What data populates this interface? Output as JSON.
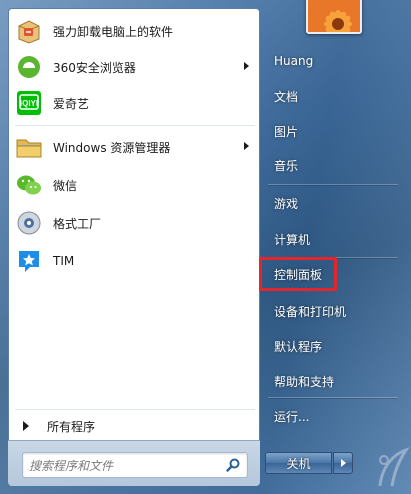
{
  "left_programs": [
    {
      "label": "强力卸载电脑上的软件",
      "icon": "uninstaller-box-icon",
      "has_submenu": false
    },
    {
      "label": "360安全浏览器",
      "icon": "360-browser-icon",
      "has_submenu": true
    },
    {
      "label": "爱奇艺",
      "icon": "iqiyi-icon",
      "has_submenu": false
    },
    {
      "label": "Windows 资源管理器",
      "icon": "explorer-folder-icon",
      "has_submenu": true
    },
    {
      "label": "微信",
      "icon": "wechat-icon",
      "has_submenu": false
    },
    {
      "label": "格式工厂",
      "icon": "format-factory-icon",
      "has_submenu": false
    },
    {
      "label": "TIM",
      "icon": "tim-icon",
      "has_submenu": false
    }
  ],
  "all_programs_label": "所有程序",
  "search": {
    "placeholder": "搜索程序和文件"
  },
  "right_items": [
    {
      "label": "Huang"
    },
    {
      "label": "文档"
    },
    {
      "label": "图片"
    },
    {
      "label": "音乐"
    },
    {
      "label": "游戏"
    },
    {
      "label": "计算机"
    },
    {
      "label": "控制面板",
      "highlighted": true
    },
    {
      "label": "设备和打印机"
    },
    {
      "label": "默认程序"
    },
    {
      "label": "帮助和支持"
    },
    {
      "label": "运行..."
    }
  ],
  "shutdown_label": "关机",
  "colors": {
    "highlight_border": "#e3262c",
    "menu_frame": "#3c6a9c"
  }
}
